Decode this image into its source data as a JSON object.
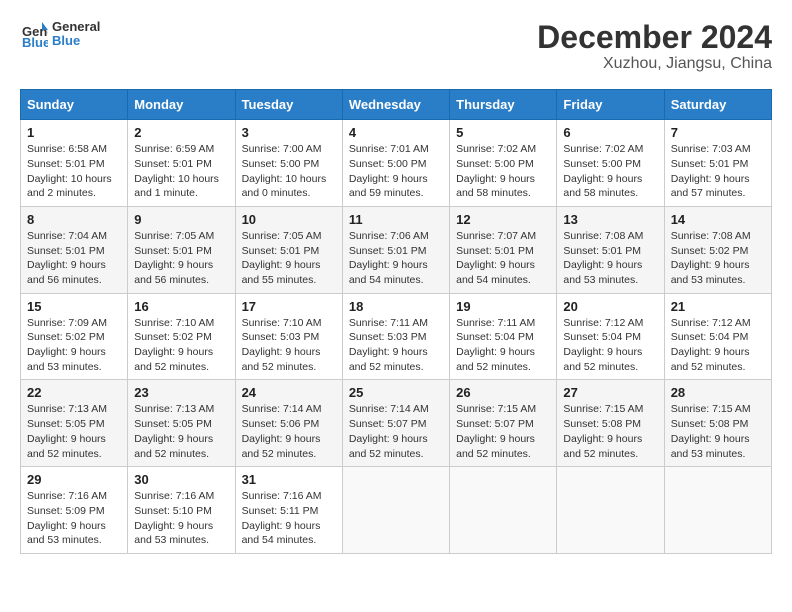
{
  "header": {
    "logo": {
      "line1": "General",
      "line2": "Blue"
    },
    "title": "December 2024",
    "subtitle": "Xuzhou, Jiangsu, China"
  },
  "weekdays": [
    "Sunday",
    "Monday",
    "Tuesday",
    "Wednesday",
    "Thursday",
    "Friday",
    "Saturday"
  ],
  "weeks": [
    [
      {
        "day": "1",
        "sunrise": "6:58 AM",
        "sunset": "5:01 PM",
        "daylight": "10 hours and 2 minutes."
      },
      {
        "day": "2",
        "sunrise": "6:59 AM",
        "sunset": "5:01 PM",
        "daylight": "10 hours and 1 minute."
      },
      {
        "day": "3",
        "sunrise": "7:00 AM",
        "sunset": "5:00 PM",
        "daylight": "10 hours and 0 minutes."
      },
      {
        "day": "4",
        "sunrise": "7:01 AM",
        "sunset": "5:00 PM",
        "daylight": "9 hours and 59 minutes."
      },
      {
        "day": "5",
        "sunrise": "7:02 AM",
        "sunset": "5:00 PM",
        "daylight": "9 hours and 58 minutes."
      },
      {
        "day": "6",
        "sunrise": "7:02 AM",
        "sunset": "5:00 PM",
        "daylight": "9 hours and 58 minutes."
      },
      {
        "day": "7",
        "sunrise": "7:03 AM",
        "sunset": "5:01 PM",
        "daylight": "9 hours and 57 minutes."
      }
    ],
    [
      {
        "day": "8",
        "sunrise": "7:04 AM",
        "sunset": "5:01 PM",
        "daylight": "9 hours and 56 minutes."
      },
      {
        "day": "9",
        "sunrise": "7:05 AM",
        "sunset": "5:01 PM",
        "daylight": "9 hours and 56 minutes."
      },
      {
        "day": "10",
        "sunrise": "7:05 AM",
        "sunset": "5:01 PM",
        "daylight": "9 hours and 55 minutes."
      },
      {
        "day": "11",
        "sunrise": "7:06 AM",
        "sunset": "5:01 PM",
        "daylight": "9 hours and 54 minutes."
      },
      {
        "day": "12",
        "sunrise": "7:07 AM",
        "sunset": "5:01 PM",
        "daylight": "9 hours and 54 minutes."
      },
      {
        "day": "13",
        "sunrise": "7:08 AM",
        "sunset": "5:01 PM",
        "daylight": "9 hours and 53 minutes."
      },
      {
        "day": "14",
        "sunrise": "7:08 AM",
        "sunset": "5:02 PM",
        "daylight": "9 hours and 53 minutes."
      }
    ],
    [
      {
        "day": "15",
        "sunrise": "7:09 AM",
        "sunset": "5:02 PM",
        "daylight": "9 hours and 53 minutes."
      },
      {
        "day": "16",
        "sunrise": "7:10 AM",
        "sunset": "5:02 PM",
        "daylight": "9 hours and 52 minutes."
      },
      {
        "day": "17",
        "sunrise": "7:10 AM",
        "sunset": "5:03 PM",
        "daylight": "9 hours and 52 minutes."
      },
      {
        "day": "18",
        "sunrise": "7:11 AM",
        "sunset": "5:03 PM",
        "daylight": "9 hours and 52 minutes."
      },
      {
        "day": "19",
        "sunrise": "7:11 AM",
        "sunset": "5:04 PM",
        "daylight": "9 hours and 52 minutes."
      },
      {
        "day": "20",
        "sunrise": "7:12 AM",
        "sunset": "5:04 PM",
        "daylight": "9 hours and 52 minutes."
      },
      {
        "day": "21",
        "sunrise": "7:12 AM",
        "sunset": "5:04 PM",
        "daylight": "9 hours and 52 minutes."
      }
    ],
    [
      {
        "day": "22",
        "sunrise": "7:13 AM",
        "sunset": "5:05 PM",
        "daylight": "9 hours and 52 minutes."
      },
      {
        "day": "23",
        "sunrise": "7:13 AM",
        "sunset": "5:05 PM",
        "daylight": "9 hours and 52 minutes."
      },
      {
        "day": "24",
        "sunrise": "7:14 AM",
        "sunset": "5:06 PM",
        "daylight": "9 hours and 52 minutes."
      },
      {
        "day": "25",
        "sunrise": "7:14 AM",
        "sunset": "5:07 PM",
        "daylight": "9 hours and 52 minutes."
      },
      {
        "day": "26",
        "sunrise": "7:15 AM",
        "sunset": "5:07 PM",
        "daylight": "9 hours and 52 minutes."
      },
      {
        "day": "27",
        "sunrise": "7:15 AM",
        "sunset": "5:08 PM",
        "daylight": "9 hours and 52 minutes."
      },
      {
        "day": "28",
        "sunrise": "7:15 AM",
        "sunset": "5:08 PM",
        "daylight": "9 hours and 53 minutes."
      }
    ],
    [
      {
        "day": "29",
        "sunrise": "7:16 AM",
        "sunset": "5:09 PM",
        "daylight": "9 hours and 53 minutes."
      },
      {
        "day": "30",
        "sunrise": "7:16 AM",
        "sunset": "5:10 PM",
        "daylight": "9 hours and 53 minutes."
      },
      {
        "day": "31",
        "sunrise": "7:16 AM",
        "sunset": "5:11 PM",
        "daylight": "9 hours and 54 minutes."
      },
      null,
      null,
      null,
      null
    ]
  ]
}
